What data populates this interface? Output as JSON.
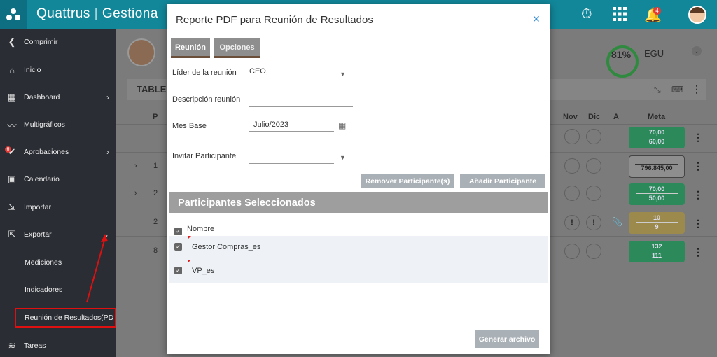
{
  "app": {
    "brand_left": "Quattrus",
    "brand_right": "Gestiona",
    "notif_count": "4"
  },
  "sidebar": {
    "items": [
      {
        "label": "Comprimir",
        "icon": "chevron-left-icon"
      },
      {
        "label": "Inicio",
        "icon": "home-icon"
      },
      {
        "label": "Dashboard",
        "icon": "dashboard-icon"
      },
      {
        "label": "Multigráficos",
        "icon": "chart-icon"
      },
      {
        "label": "Aprobaciones",
        "icon": "approval-icon",
        "badge": "6"
      },
      {
        "label": "Calendario",
        "icon": "calendar-icon"
      },
      {
        "label": "Importar",
        "icon": "import-icon"
      },
      {
        "label": "Exportar",
        "icon": "export-icon"
      },
      {
        "label": "Mediciones"
      },
      {
        "label": "Indicadores"
      },
      {
        "label": "Reunión de Resultados(PD"
      },
      {
        "label": "Tareas",
        "icon": "layers-icon"
      }
    ]
  },
  "background": {
    "score": "81%",
    "user_code": "EGU",
    "table_title": "TABLER",
    "col_p": "P",
    "col_nov": "Nov",
    "col_dic": "Dic",
    "col_a": "A",
    "col_meta": "Meta",
    "rows": [
      "1",
      "2",
      "2",
      "8"
    ],
    "metas": [
      [
        "70,00",
        "60,00"
      ],
      [
        "796.845,00"
      ],
      [
        "70,00",
        "50,00"
      ],
      [
        "10",
        "9"
      ],
      [
        "132",
        "111"
      ]
    ]
  },
  "modal": {
    "title": "Reporte PDF para Reunión de Resultados",
    "tabs": [
      "Reunión",
      "Opciones"
    ],
    "lider_label": "Líder de la reunión",
    "lider_value": "CEO,",
    "desc_label": "Descripción reunión",
    "desc_value": "",
    "mes_label": "Mes Base",
    "mes_value": "Julio/2023",
    "invitar_label": "Invitar Participante",
    "invitar_value": "",
    "remove_btn": "Remover Participante(s)",
    "add_btn": "Añadir Participante",
    "section_title": "Participantes Seleccionados",
    "col_nombre": "Nombre",
    "participants": [
      "Gestor Compras_es",
      "VP_es"
    ],
    "generate_btn": "Generar archivo"
  }
}
